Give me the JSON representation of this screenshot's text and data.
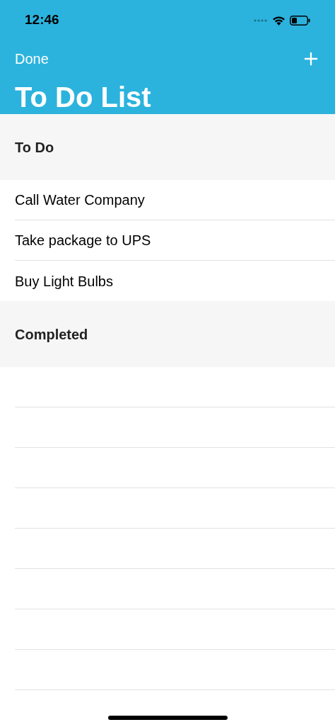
{
  "status_bar": {
    "time": "12:46"
  },
  "nav_bar": {
    "left_button": "Done",
    "title": "To Do List"
  },
  "sections": [
    {
      "title": "To Do",
      "items": [
        "Call Water Company",
        "Take package to UPS",
        "Buy Light Bulbs"
      ]
    },
    {
      "title": "Completed"
    }
  ]
}
